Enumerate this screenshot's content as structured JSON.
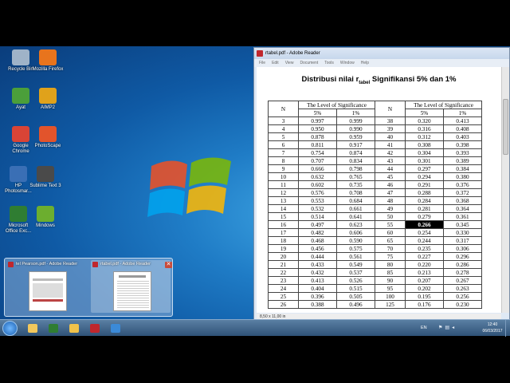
{
  "desktop_icons": [
    {
      "label": "Recycle Bin",
      "icon": "recycle-bin-icon",
      "color": "#9fb3c8"
    },
    {
      "label": "Mozilla Firefox",
      "icon": "firefox-icon",
      "color": "#e8741d"
    },
    {
      "label": "Ayat",
      "icon": "ayat-icon",
      "color": "#4b9f3a"
    },
    {
      "label": "AIMP2",
      "icon": "aimp-icon",
      "color": "#e0a21b"
    },
    {
      "label": "Google Chrome",
      "icon": "chrome-icon",
      "color": "#d94436"
    },
    {
      "label": "PhotoScape",
      "icon": "photoscape-icon",
      "color": "#e2542c"
    },
    {
      "label": "HP Photosmar...",
      "icon": "hp-photosmart-icon",
      "color": "#3a6fb5"
    },
    {
      "label": "Sublime Text 3",
      "icon": "sublime-text-icon",
      "color": "#4a4a4a"
    },
    {
      "label": "Microsoft Office Exc...",
      "icon": "excel-icon",
      "color": "#2f7d32"
    },
    {
      "label": "Mindows",
      "icon": "mindows-icon",
      "color": "#6cae2f"
    }
  ],
  "reader": {
    "title": "rtabel.pdf - Adobe Reader",
    "menu": [
      "File",
      "Edit",
      "View",
      "Document",
      "Tools",
      "Window",
      "Help"
    ],
    "doc_title_main": "Distribusi nilai r",
    "doc_title_sub": "tabel",
    "doc_title_rest": " Signifikansi 5% dan 1%",
    "table_headers": {
      "n": "N",
      "level": "The Level of Significance",
      "p5": "5%",
      "p1": "1%"
    },
    "left_rows": [
      [
        "3",
        "0.997",
        "0.999"
      ],
      [
        "4",
        "0.950",
        "0.990"
      ],
      [
        "5",
        "0.878",
        "0.959"
      ],
      [
        "6",
        "0.811",
        "0.917"
      ],
      [
        "7",
        "0.754",
        "0.874"
      ],
      [
        "8",
        "0.707",
        "0.834"
      ],
      [
        "9",
        "0.666",
        "0.798"
      ],
      [
        "10",
        "0.632",
        "0.765"
      ],
      [
        "11",
        "0.602",
        "0.735"
      ],
      [
        "12",
        "0.576",
        "0.708"
      ],
      [
        "13",
        "0.553",
        "0.684"
      ],
      [
        "14",
        "0.532",
        "0.661"
      ],
      [
        "15",
        "0.514",
        "0.641"
      ],
      [
        "16",
        "0.497",
        "0.623"
      ],
      [
        "17",
        "0.482",
        "0.606"
      ],
      [
        "18",
        "0.468",
        "0.590"
      ],
      [
        "19",
        "0.456",
        "0.575"
      ],
      [
        "20",
        "0.444",
        "0.561"
      ],
      [
        "21",
        "0.433",
        "0.549"
      ],
      [
        "22",
        "0.432",
        "0.537"
      ],
      [
        "23",
        "0.413",
        "0.526"
      ],
      [
        "24",
        "0.404",
        "0.515"
      ],
      [
        "25",
        "0.396",
        "0.505"
      ],
      [
        "26",
        "0.388",
        "0.496"
      ]
    ],
    "right_rows": [
      [
        "38",
        "0.320",
        "0.413"
      ],
      [
        "39",
        "0.316",
        "0.408"
      ],
      [
        "40",
        "0.312",
        "0.403"
      ],
      [
        "41",
        "0.308",
        "0.398"
      ],
      [
        "42",
        "0.304",
        "0.393"
      ],
      [
        "43",
        "0.301",
        "0.389"
      ],
      [
        "44",
        "0.297",
        "0.384"
      ],
      [
        "45",
        "0.294",
        "0.380"
      ],
      [
        "46",
        "0.291",
        "0.376"
      ],
      [
        "47",
        "0.288",
        "0.372"
      ],
      [
        "48",
        "0.284",
        "0.368"
      ],
      [
        "49",
        "0.281",
        "0.364"
      ],
      [
        "50",
        "0.279",
        "0.361"
      ],
      [
        "55",
        "0.266",
        "0.345"
      ],
      [
        "60",
        "0.254",
        "0.330"
      ],
      [
        "65",
        "0.244",
        "0.317"
      ],
      [
        "70",
        "0.235",
        "0.306"
      ],
      [
        "75",
        "0.227",
        "0.296"
      ],
      [
        "80",
        "0.220",
        "0.286"
      ],
      [
        "85",
        "0.213",
        "0.278"
      ],
      [
        "90",
        "0.207",
        "0.267"
      ],
      [
        "95",
        "0.202",
        "0.263"
      ],
      [
        "100",
        "0.195",
        "0.256"
      ],
      [
        "125",
        "0.176",
        "0.230"
      ]
    ],
    "highlighted_value": "0.266",
    "page_size": "8,50 x 11,00 in"
  },
  "thumbnails": [
    {
      "label": "tel Pearson.pdf - Adobe Reader"
    },
    {
      "label": "rtabel.pdf - Adobe Reader"
    }
  ],
  "taskbar": {
    "apps": [
      {
        "icon": "windows-explorer-icon",
        "color": "#f2c85c"
      },
      {
        "icon": "excel-taskbar-icon",
        "color": "#2f7d32"
      },
      {
        "icon": "folder-icon",
        "color": "#f0c24a"
      },
      {
        "icon": "adobe-reader-icon",
        "color": "#c0272d"
      },
      {
        "icon": "network-icon",
        "color": "#3b8ad8"
      }
    ],
    "language": "EN",
    "time": "12:40",
    "date": "06/03/2017"
  }
}
